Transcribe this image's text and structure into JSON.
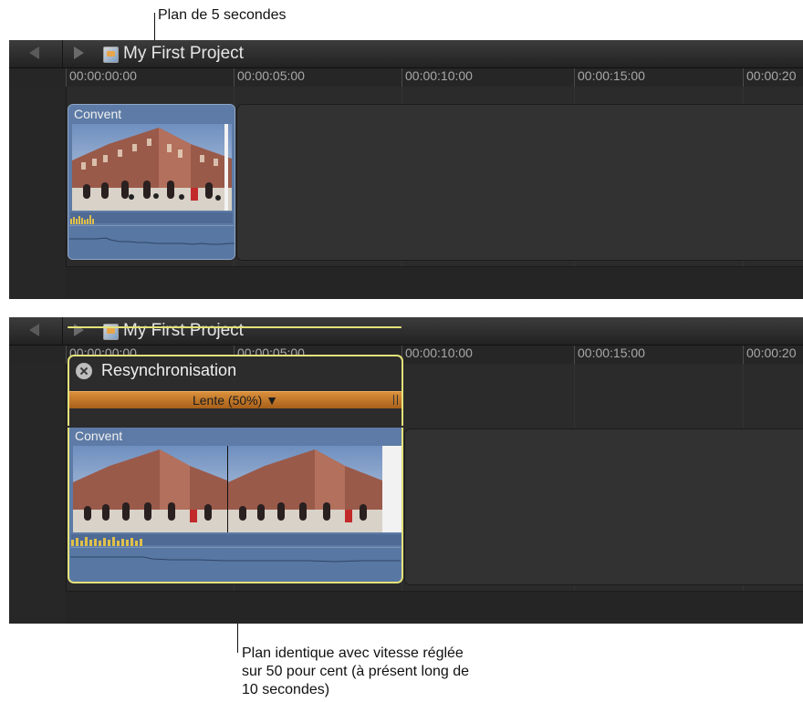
{
  "callouts": {
    "top": "Plan de 5 secondes",
    "bottom_line1": "Plan identique avec vitesse réglée",
    "bottom_line2": "sur 50 pour cent (à présent long de",
    "bottom_line3": "10 secondes)"
  },
  "timeline_top": {
    "project_title": "My First Project",
    "ruler": [
      "00:00:00:00",
      "00:00:05:00",
      "00:00:10:00",
      "00:00:15:00",
      "00:00:20"
    ],
    "clip": {
      "name": "Convent"
    }
  },
  "timeline_bottom": {
    "project_title": "My First Project",
    "ruler": [
      "00:00:00:00",
      "00:00:05:00",
      "00:00:10:00",
      "00:00:15:00",
      "00:00:20"
    ],
    "retime": {
      "title": "Resynchronisation",
      "speed": "Lente (50%) ▼"
    },
    "clip": {
      "name": "Convent"
    }
  },
  "colors": {
    "clip": "#5d7ba6",
    "selection": "#e4e27a",
    "speed_bar": "#c57a2a",
    "panel": "#2b2b2b"
  },
  "icons": [
    "back-arrow-icon",
    "forward-arrow-icon",
    "project-icon",
    "close-icon",
    "grip-icon"
  ]
}
